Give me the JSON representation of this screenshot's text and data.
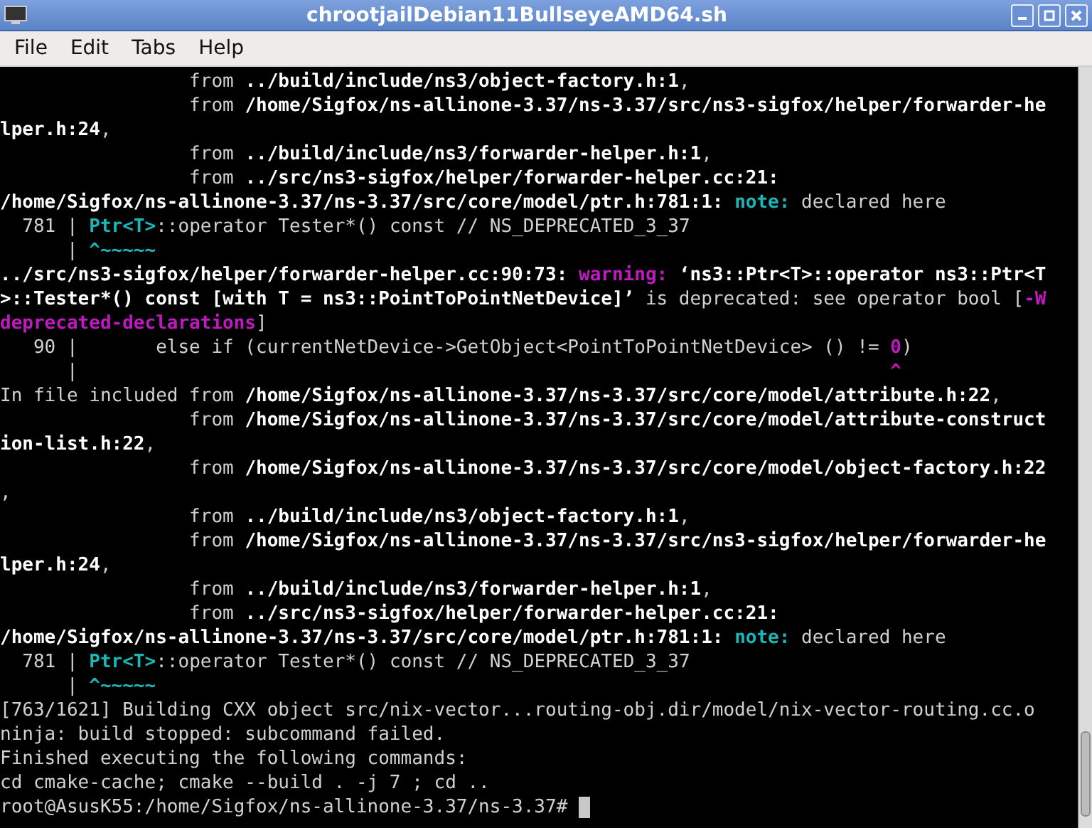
{
  "window": {
    "title": "chrootjailDebian11BullseyeAMD64.sh"
  },
  "menu": [
    "File",
    "Edit",
    "Tabs",
    "Help"
  ],
  "terminal": {
    "lines": [
      [
        {
          "text": "                 from "
        },
        {
          "text": "../build/include/ns3/object-factory.h:1",
          "kind": "path"
        },
        {
          "text": ","
        }
      ],
      [
        {
          "text": "                 from "
        },
        {
          "text": "/home/Sigfox/ns-allinone-3.37/ns-3.37/src/ns3-sigfox/helper/forwarder-he",
          "kind": "path"
        }
      ],
      [
        {
          "text": "lper.h:24",
          "kind": "path"
        },
        {
          "text": ","
        }
      ],
      [
        {
          "text": "                 from "
        },
        {
          "text": "../build/include/ns3/forwarder-helper.h:1",
          "kind": "path"
        },
        {
          "text": ","
        }
      ],
      [
        {
          "text": "                 from "
        },
        {
          "text": "../src/ns3-sigfox/helper/forwarder-helper.cc:21:",
          "kind": "path"
        }
      ],
      [
        {
          "text": "/home/Sigfox/ns-allinone-3.37/ns-3.37/src/core/model/ptr.h:781:1: ",
          "kind": "path"
        },
        {
          "text": "note:",
          "kind": "note"
        },
        {
          "text": " declared here"
        }
      ],
      [
        {
          "text": "  781 | "
        },
        {
          "text": "Ptr<T>",
          "kind": "note"
        },
        {
          "text": "::operator Tester*() const // NS_DEPRECATED_3_37"
        }
      ],
      [
        {
          "text": "      | "
        },
        {
          "text": "^~~~~~",
          "kind": "note"
        }
      ],
      [
        {
          "text": "../src/ns3-sigfox/helper/forwarder-helper.cc:90:73: ",
          "kind": "path"
        },
        {
          "text": "warning:",
          "kind": "warning"
        },
        {
          "text": " ‘ns3::Ptr<T>::operator ns3::Ptr<T",
          "kind": "path"
        }
      ],
      [
        {
          "text": ">::Tester*() const [with T = ns3::PointToPointNetDevice]’",
          "kind": "path"
        },
        {
          "text": " is deprecated: see operator bool ["
        },
        {
          "text": "-W",
          "kind": "warning"
        }
      ],
      [
        {
          "text": "deprecated-declarations",
          "kind": "warning"
        },
        {
          "text": "]"
        }
      ],
      [
        {
          "text": "   90 |       else if (currentNetDevice->GetObject<PointToPointNetDevice> () != "
        },
        {
          "text": "0",
          "kind": "warning"
        },
        {
          "text": ")"
        }
      ],
      [
        {
          "text": "      |                                                                         "
        },
        {
          "text": "^",
          "kind": "warning"
        }
      ],
      [
        {
          "text": "In file included from "
        },
        {
          "text": "/home/Sigfox/ns-allinone-3.37/ns-3.37/src/core/model/attribute.h:22",
          "kind": "path"
        },
        {
          "text": ","
        }
      ],
      [
        {
          "text": "                 from "
        },
        {
          "text": "/home/Sigfox/ns-allinone-3.37/ns-3.37/src/core/model/attribute-construct",
          "kind": "path"
        }
      ],
      [
        {
          "text": "ion-list.h:22",
          "kind": "path"
        },
        {
          "text": ","
        }
      ],
      [
        {
          "text": "                 from "
        },
        {
          "text": "/home/Sigfox/ns-allinone-3.37/ns-3.37/src/core/model/object-factory.h:22",
          "kind": "path"
        }
      ],
      [
        {
          "text": ","
        }
      ],
      [
        {
          "text": "                 from "
        },
        {
          "text": "../build/include/ns3/object-factory.h:1",
          "kind": "path"
        },
        {
          "text": ","
        }
      ],
      [
        {
          "text": "                 from "
        },
        {
          "text": "/home/Sigfox/ns-allinone-3.37/ns-3.37/src/ns3-sigfox/helper/forwarder-he",
          "kind": "path"
        }
      ],
      [
        {
          "text": "lper.h:24",
          "kind": "path"
        },
        {
          "text": ","
        }
      ],
      [
        {
          "text": "                 from "
        },
        {
          "text": "../build/include/ns3/forwarder-helper.h:1",
          "kind": "path"
        },
        {
          "text": ","
        }
      ],
      [
        {
          "text": "                 from "
        },
        {
          "text": "../src/ns3-sigfox/helper/forwarder-helper.cc:21:",
          "kind": "path"
        }
      ],
      [
        {
          "text": "/home/Sigfox/ns-allinone-3.37/ns-3.37/src/core/model/ptr.h:781:1: ",
          "kind": "path"
        },
        {
          "text": "note:",
          "kind": "note"
        },
        {
          "text": " declared here"
        }
      ],
      [
        {
          "text": "  781 | "
        },
        {
          "text": "Ptr<T>",
          "kind": "note"
        },
        {
          "text": "::operator Tester*() const // NS_DEPRECATED_3_37"
        }
      ],
      [
        {
          "text": "      | "
        },
        {
          "text": "^~~~~~",
          "kind": "note"
        }
      ],
      [
        {
          "text": "[763/1621] Building CXX object src/nix-vector...routing-obj.dir/model/nix-vector-routing.cc.o"
        }
      ],
      [
        {
          "text": "ninja: build stopped: subcommand failed."
        }
      ],
      [
        {
          "text": "Finished executing the following commands:"
        }
      ],
      [
        {
          "text": "cd cmake-cache; cmake --build . -j 7 ; cd .."
        }
      ],
      [
        {
          "text": "root@AsusK55:/home/Sigfox/ns-allinone-3.37/ns-3.37# "
        }
      ]
    ]
  }
}
